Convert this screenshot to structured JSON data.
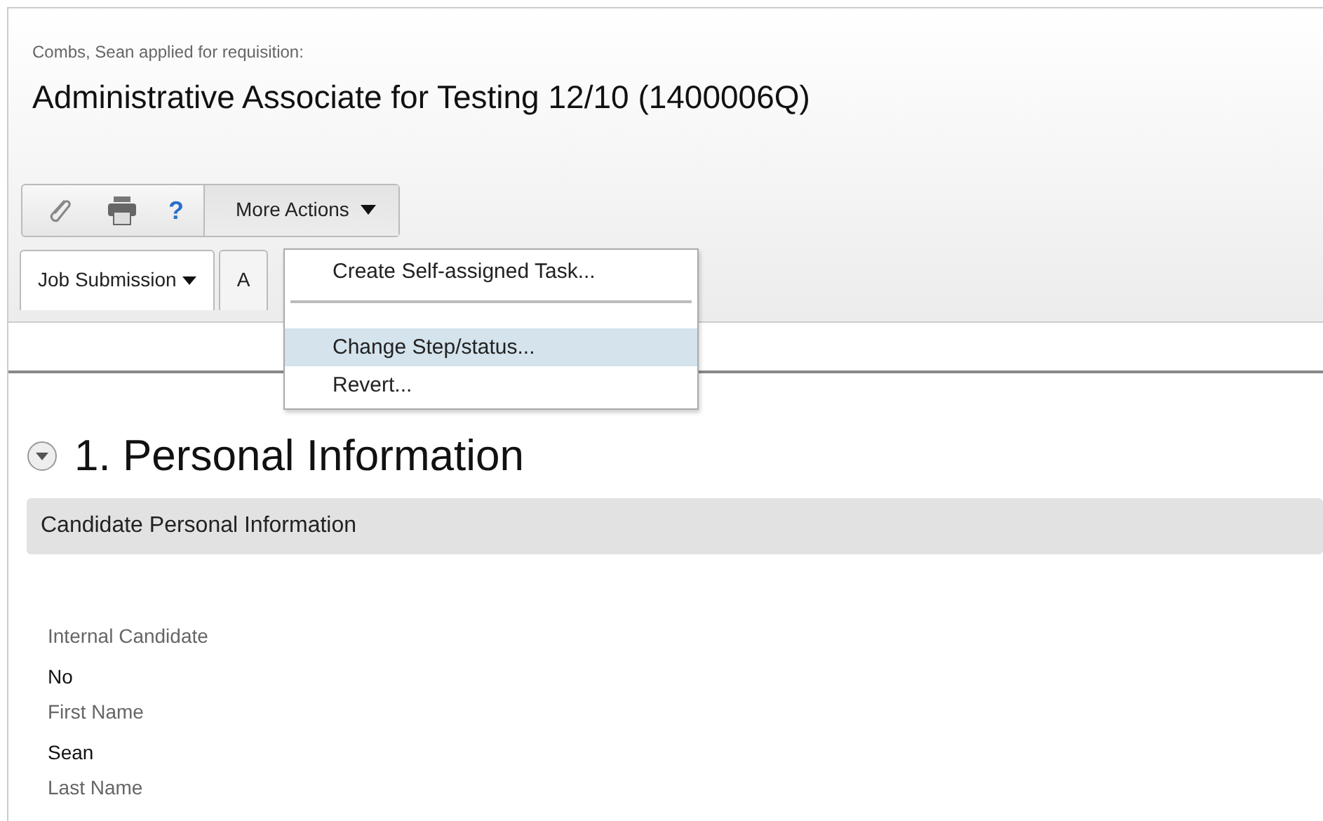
{
  "header": {
    "subtitle": "Combs, Sean applied for requisition:",
    "title": "Administrative Associate for Testing 12/10 (1400006Q)"
  },
  "toolbar": {
    "help_glyph": "?",
    "more_actions": {
      "label": "More Actions",
      "expanded": true
    }
  },
  "tabs": [
    {
      "label": "Job Submission",
      "selected": true
    },
    {
      "label": "A",
      "selected": false
    }
  ],
  "menu": [
    {
      "kind": "item",
      "label": "Create Self-assigned Task...",
      "highlighted": false
    },
    {
      "kind": "separator"
    },
    {
      "kind": "item",
      "label": "Change Step/status...",
      "highlighted": true
    },
    {
      "kind": "item",
      "label": "Revert...",
      "highlighted": false
    }
  ],
  "section": {
    "title": "1. Personal Information",
    "expanded": true,
    "subsection": "Candidate Personal Information"
  },
  "fields": [
    {
      "label": "Internal Candidate",
      "value": "No"
    },
    {
      "label": "First Name",
      "value": "Sean"
    },
    {
      "label": "Last Name"
    }
  ]
}
